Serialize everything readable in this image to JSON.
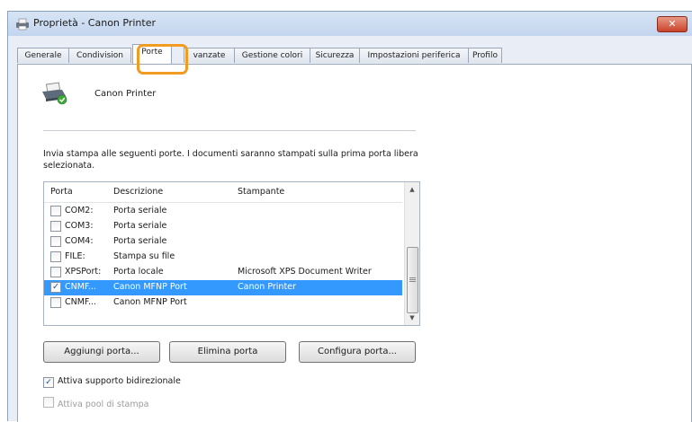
{
  "window": {
    "title": "Proprietà - Canon Printer",
    "close_symbol": "✕"
  },
  "tabs": [
    {
      "label": "Generale"
    },
    {
      "label": "Condivision"
    },
    {
      "label": "Porte"
    },
    {
      "label": "vanzate"
    },
    {
      "label": "Gestione colori"
    },
    {
      "label": "Sicurezza"
    },
    {
      "label": "Impostazioni periferica"
    },
    {
      "label": "Profilo"
    }
  ],
  "active_tab": "Porte",
  "highlight_color": "#f19b21",
  "printer": {
    "name": "Canon Printer"
  },
  "description": "Invia stampa alle seguenti porte. I documenti saranno stampati sulla prima porta libera selezionata.",
  "port_table": {
    "columns": [
      "Porta",
      "Descrizione",
      "Stampante"
    ],
    "rows": [
      {
        "checked": false,
        "port": "COM2:",
        "description": "Porta seriale",
        "printer": "",
        "selected": false
      },
      {
        "checked": false,
        "port": "COM3:",
        "description": "Porta seriale",
        "printer": "",
        "selected": false
      },
      {
        "checked": false,
        "port": "COM4:",
        "description": "Porta seriale",
        "printer": "",
        "selected": false
      },
      {
        "checked": false,
        "port": "FILE:",
        "description": "Stampa su file",
        "printer": "",
        "selected": false
      },
      {
        "checked": false,
        "port": "XPSPort:",
        "description": "Porta locale",
        "printer": "Microsoft XPS Document Writer",
        "selected": false
      },
      {
        "checked": true,
        "port": "CNMF...",
        "description": "Canon MFNP Port",
        "printer": "Canon Printer",
        "selected": true
      },
      {
        "checked": false,
        "port": "CNMF...",
        "description": "Canon MFNP Port",
        "printer": "",
        "selected": false
      }
    ],
    "selection_color": "#3399ff"
  },
  "buttons": {
    "add": "Aggiungi porta...",
    "delete": "Elimina porta",
    "configure": "Configura porta..."
  },
  "options": {
    "bidirectional": {
      "label": "Attiva supporto bidirezionale",
      "checked": true,
      "enabled": true
    },
    "pooling": {
      "label": "Attiva pool di stampa",
      "checked": false,
      "enabled": false
    }
  }
}
